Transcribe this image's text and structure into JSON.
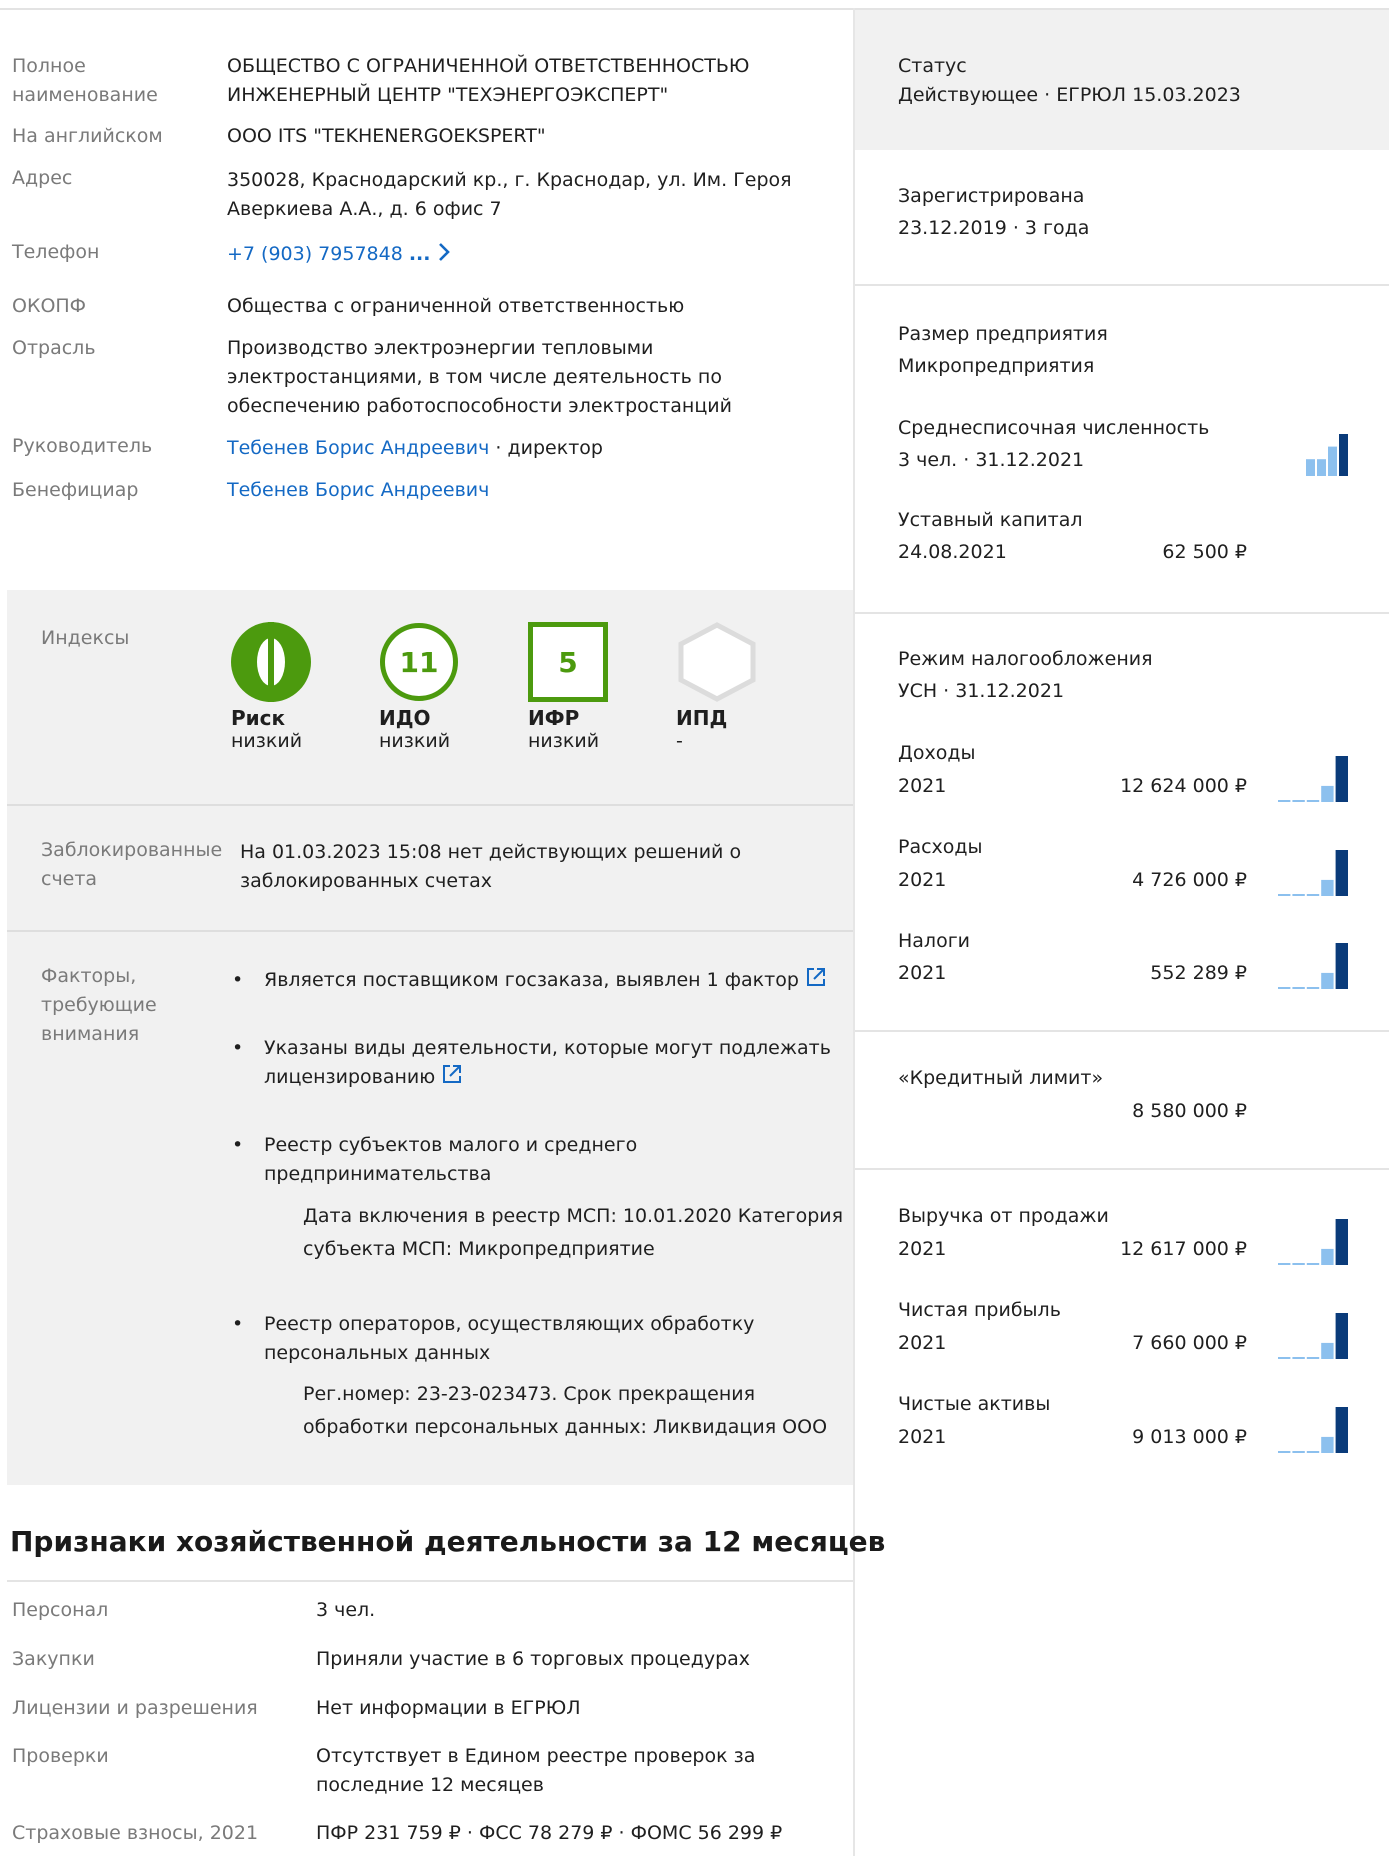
{
  "general": {
    "full_name_label": "Полное наименование",
    "full_name_value_1": "ОБЩЕСТВО С ОГРАНИЧЕННОЙ ОТВЕТСТВЕННОСТЬЮ",
    "full_name_value_2": "ИНЖЕНЕРНЫЙ ЦЕНТР \"ТЕХЭНЕРГОЭКСПЕРТ\"",
    "english_label": "На английском",
    "english_value": "ООО ITS \"TEKHENERGOEKSPERT\"",
    "address_label": "Адрес",
    "address_value_1": "350028, Краснодарский кр., г. Краснодар, ул. Им. Героя",
    "address_value_2": "Аверкиева А.А., д. 6 офис 7",
    "phone_label": "Телефон",
    "phone_value": "+7 (903) 7957848",
    "phone_more": "...",
    "okopf_label": "ОКОПФ",
    "okopf_value": "Общества с ограниченной ответственностью",
    "industry_label": "Отрасль",
    "industry_value_1": "Производство электроэнергии тепловыми",
    "industry_value_2": "электростанциями, в том числе деятельность по",
    "industry_value_3": "обеспечению работоспособности электростанций",
    "head_label": "Руководитель",
    "head_name": "Тебенев Борис Андреевич",
    "head_role": "· директор",
    "beneficiary_label": "Бенефициар",
    "beneficiary_name": "Тебенев Борис Андреевич"
  },
  "indexes": {
    "label": "Индексы",
    "items": [
      {
        "title": "Риск",
        "status": "низкий"
      },
      {
        "title": "ИДО",
        "number": "11",
        "status": "низкий"
      },
      {
        "title": "ИФР",
        "number": "5",
        "status": "низкий"
      },
      {
        "title": "ИПД",
        "status": "-"
      }
    ]
  },
  "blocked": {
    "label_1": "Заблокированные",
    "label_2": "счета",
    "text_1": "На 01.03.2023 15:08 нет действующих решений о",
    "text_2": "заблокированных счетах"
  },
  "factors": {
    "label_1": "Факторы,",
    "label_2": "требующие",
    "label_3": "внимания",
    "f1": "Является поставщиком госзаказа, выявлен 1 фактор",
    "f2_1": "Указаны виды деятельности, которые могут подлежать",
    "f2_2": "лицензированию",
    "f3_1": "Реестр субъектов малого и среднего",
    "f3_2": "предпринимательства",
    "f3_sub_1": "Дата включения в реестр МСП: 10.01.2020 Категория",
    "f3_sub_2": "субъекта МСП: Микропредприятие",
    "f4_1": "Реестр операторов, осуществляющих обработку",
    "f4_2": "персональных данных",
    "f4_sub_1": "Рег.номер: 23-23-023473. Срок прекращения",
    "f4_sub_2": "обработки персональных данных: Ликвидация ООО"
  },
  "activity": {
    "title": "Признаки хозяйственной деятельности за 12 месяцев",
    "rows": [
      {
        "label": "Персонал",
        "value": "3 чел."
      },
      {
        "label": "Закупки",
        "value": "Приняли участие в 6 торговых процедурах"
      },
      {
        "label": "Лицензии и разрешения",
        "value": "Нет информации в ЕГРЮЛ"
      },
      {
        "label": "Проверки",
        "value": "Отсутствует в Едином реестре проверок за",
        "value_2": "последние 12 месяцев"
      },
      {
        "label": "Страховые взносы, 2021",
        "value": "ПФР 231 759 ₽ · ФСС 78 279 ₽ · ФОМС 56 299 ₽"
      }
    ]
  },
  "sidebar": {
    "status_label": "Статус",
    "status_value": "Действующее · ЕГРЮЛ 15.03.2023",
    "registered_label": "Зарегистрирована",
    "registered_value": "23.12.2019 · 3 года",
    "size_label": "Размер предприятия",
    "size_value": "Микропредприятия",
    "employees_label": "Среднесписочная численность",
    "employees_value": "3 чел. · 31.12.2021",
    "capital_label": "Уставный капитал",
    "capital_date": "24.08.2021",
    "capital_value": "62 500 ₽",
    "tax_label": "Режим налогообложения",
    "tax_value": "УСН · 31.12.2021",
    "income_label": "Доходы",
    "income_year": "2021",
    "income_value": "12 624 000 ₽",
    "expenses_label": "Расходы",
    "expenses_year": "2021",
    "expenses_value": "4 726 000 ₽",
    "taxes_label": "Налоги",
    "taxes_year": "2021",
    "taxes_value": "552 289 ₽",
    "credit_label": "«Кредитный лимит»",
    "credit_value": "8 580 000 ₽",
    "revenue_label": "Выручка от продажи",
    "revenue_year": "2021",
    "revenue_value": "12 617 000 ₽",
    "profit_label": "Чистая прибыль",
    "profit_year": "2021",
    "profit_value": "7 660 000 ₽",
    "assets_label": "Чистые активы",
    "assets_year": "2021",
    "assets_value": "9 013 000 ₽"
  },
  "colors": {
    "link": "#1469c4",
    "green": "#4c9a0e",
    "bar_dark": "#0a3b7a",
    "bar_light": "#8cc0ee"
  }
}
